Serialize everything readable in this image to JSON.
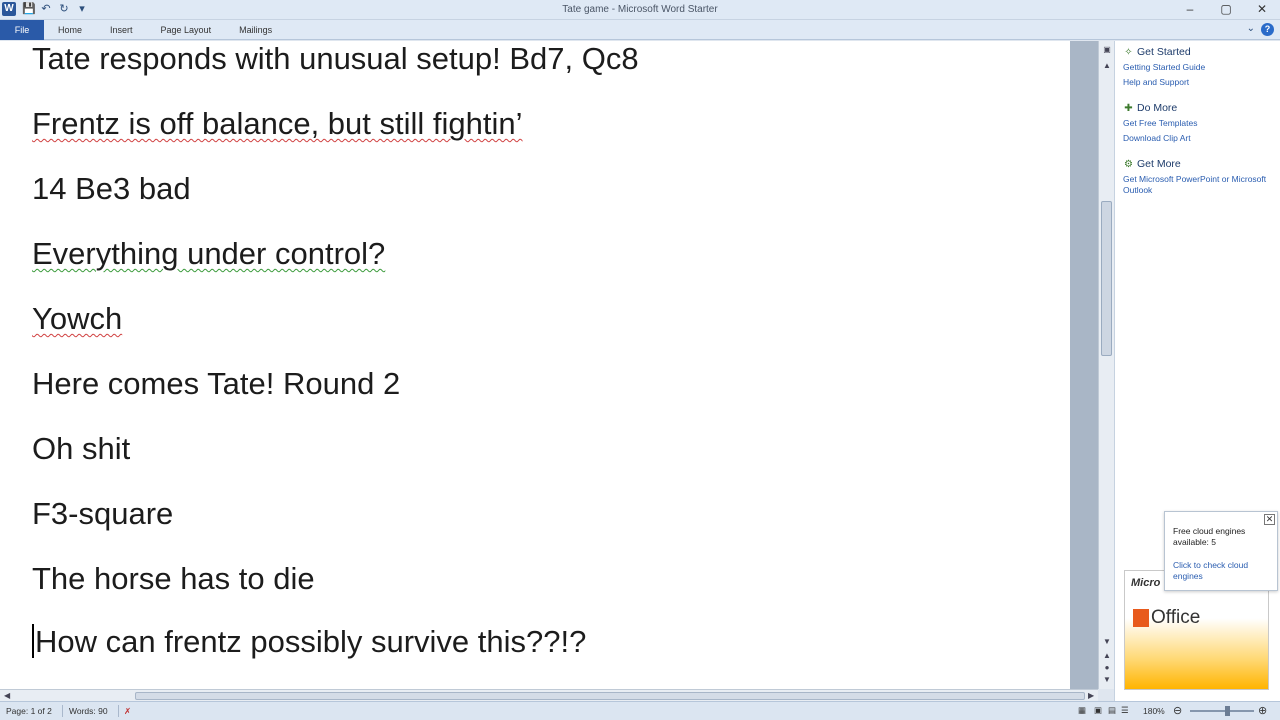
{
  "window": {
    "title": "Tate game  -  Microsoft Word Starter",
    "app_icon": "W",
    "controls": [
      "–",
      "▢",
      "✕"
    ]
  },
  "quick_access": {
    "icons": [
      "save-icon",
      "undo-icon",
      "redo-icon",
      "customize-icon"
    ]
  },
  "ribbon": {
    "tabs": [
      "File",
      "Home",
      "Insert",
      "Page Layout",
      "Mailings"
    ],
    "help": "?"
  },
  "document": {
    "lines": [
      "Tate responds with unusual setup!  Bd7, Qc8",
      "Frentz is off balance, but still fightin’",
      "14 Be3 bad",
      "Everything under control?",
      "Yowch",
      "Here comes Tate!  Round 2",
      "Oh shit",
      "F3-square",
      "The horse has to die",
      "How can frentz possibly survive this??!?"
    ]
  },
  "task_pane": {
    "sections": [
      {
        "title": "Get Started",
        "links": [
          "Getting Started Guide",
          "Help and Support"
        ]
      },
      {
        "title": "Do More",
        "links": [
          "Get Free Templates",
          "Download Clip Art"
        ]
      },
      {
        "title": "Get More",
        "links": [
          "Get Microsoft PowerPoint or Microsoft Outlook"
        ]
      }
    ]
  },
  "popup": {
    "message": "Free cloud engines available: 5",
    "link": "Click to check cloud engines",
    "close": "✕"
  },
  "ad": {
    "brand": "Micro",
    "product": "Office"
  },
  "status_bar": {
    "page": "Page: 1 of 2",
    "words": "Words: 90",
    "zoom": "180%"
  }
}
